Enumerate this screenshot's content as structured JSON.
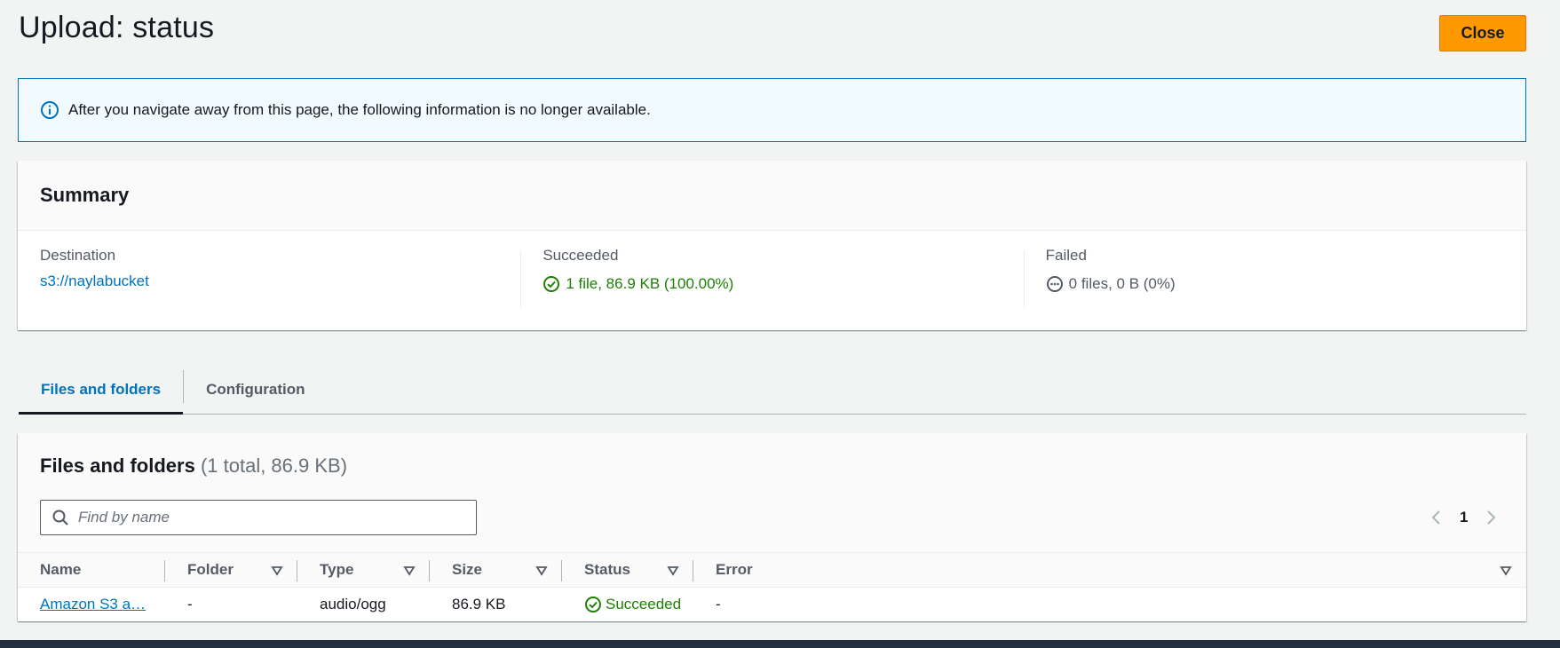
{
  "page": {
    "title": "Upload: status",
    "close_label": "Close"
  },
  "alert": {
    "icon": "info-icon",
    "text": "After you navigate away from this page, the following information is no longer available."
  },
  "summary": {
    "title": "Summary",
    "destination": {
      "label": "Destination",
      "value": "s3://naylabucket"
    },
    "succeeded": {
      "label": "Succeeded",
      "value": "1 file, 86.9 KB (100.00%)",
      "icon": "success-check-icon"
    },
    "failed": {
      "label": "Failed",
      "value": "0 files, 0 B (0%)",
      "icon": "pending-dots-icon"
    }
  },
  "tabs": [
    {
      "label": "Files and folders",
      "active": true
    },
    {
      "label": "Configuration",
      "active": false
    }
  ],
  "files": {
    "title": "Files and folders",
    "count": "(1 total, 86.9 KB)",
    "search_placeholder": "Find by name",
    "page": "1",
    "columns": [
      "Name",
      "Folder",
      "Type",
      "Size",
      "Status",
      "Error"
    ],
    "rows": [
      {
        "name": "Amazon S3 a…",
        "folder": "-",
        "type": "audio/ogg",
        "size": "86.9 KB",
        "status": "Succeeded",
        "error": "-"
      }
    ]
  },
  "colors": {
    "accent": "#0073bb",
    "primary_button": "#ff9900",
    "success": "#1d8102"
  }
}
